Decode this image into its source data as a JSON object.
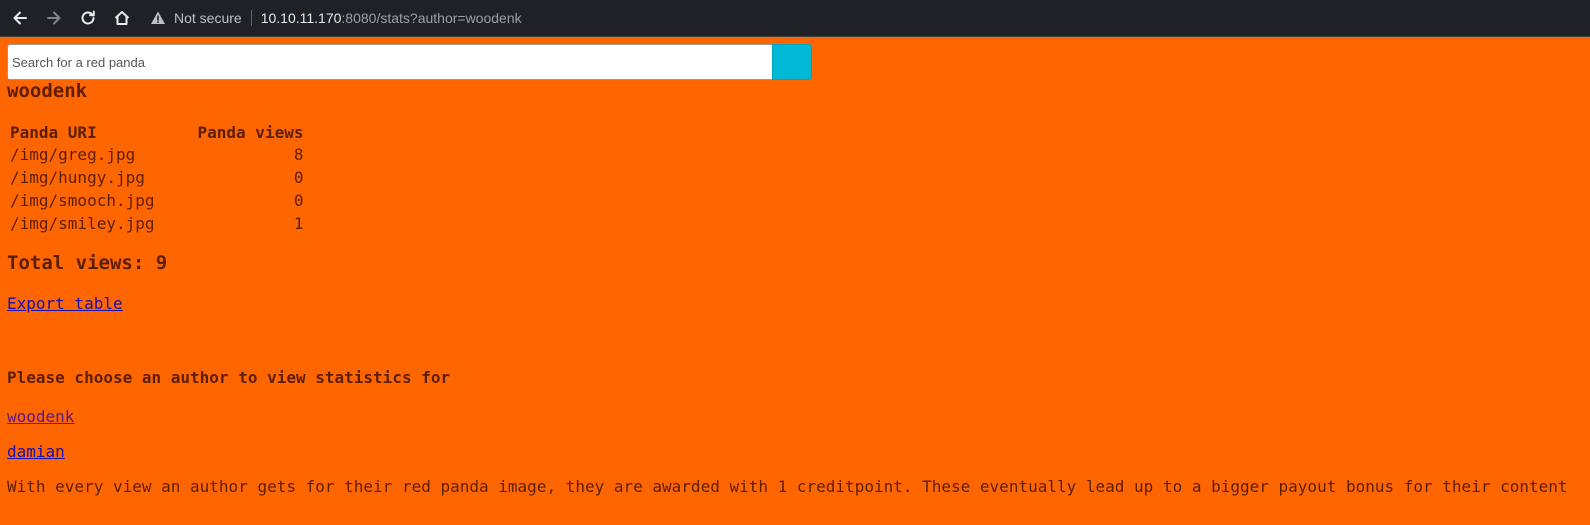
{
  "browser": {
    "security_label": "Not secure",
    "url_host": "10.10.11.170",
    "url_rest": ":8080/stats?author=woodenk",
    "icons": [
      "back-arrow-icon",
      "forward-arrow-icon",
      "reload-icon",
      "home-icon",
      "warning-icon"
    ]
  },
  "search": {
    "placeholder": "Search for a red panda",
    "button_color": "#00b8d4"
  },
  "page": {
    "background_color": "#ff6600",
    "author": "woodenk",
    "table": {
      "headers": [
        "Panda URI",
        "Panda views"
      ],
      "rows": [
        {
          "uri": "/img/greg.jpg",
          "views": "8"
        },
        {
          "uri": "/img/hungy.jpg",
          "views": "0"
        },
        {
          "uri": "/img/smooch.jpg",
          "views": "0"
        },
        {
          "uri": "/img/smiley.jpg",
          "views": "1"
        }
      ]
    },
    "total_views": "Total views: 9",
    "export_link": "Export table",
    "choose_heading": "Please choose an author to view statistics for",
    "authors": [
      "woodenk",
      "damian"
    ],
    "note": "With every view an author gets for their red panda image, they are awarded with 1 creditpoint. These eventually lead up to a bigger payout bonus for their content"
  }
}
